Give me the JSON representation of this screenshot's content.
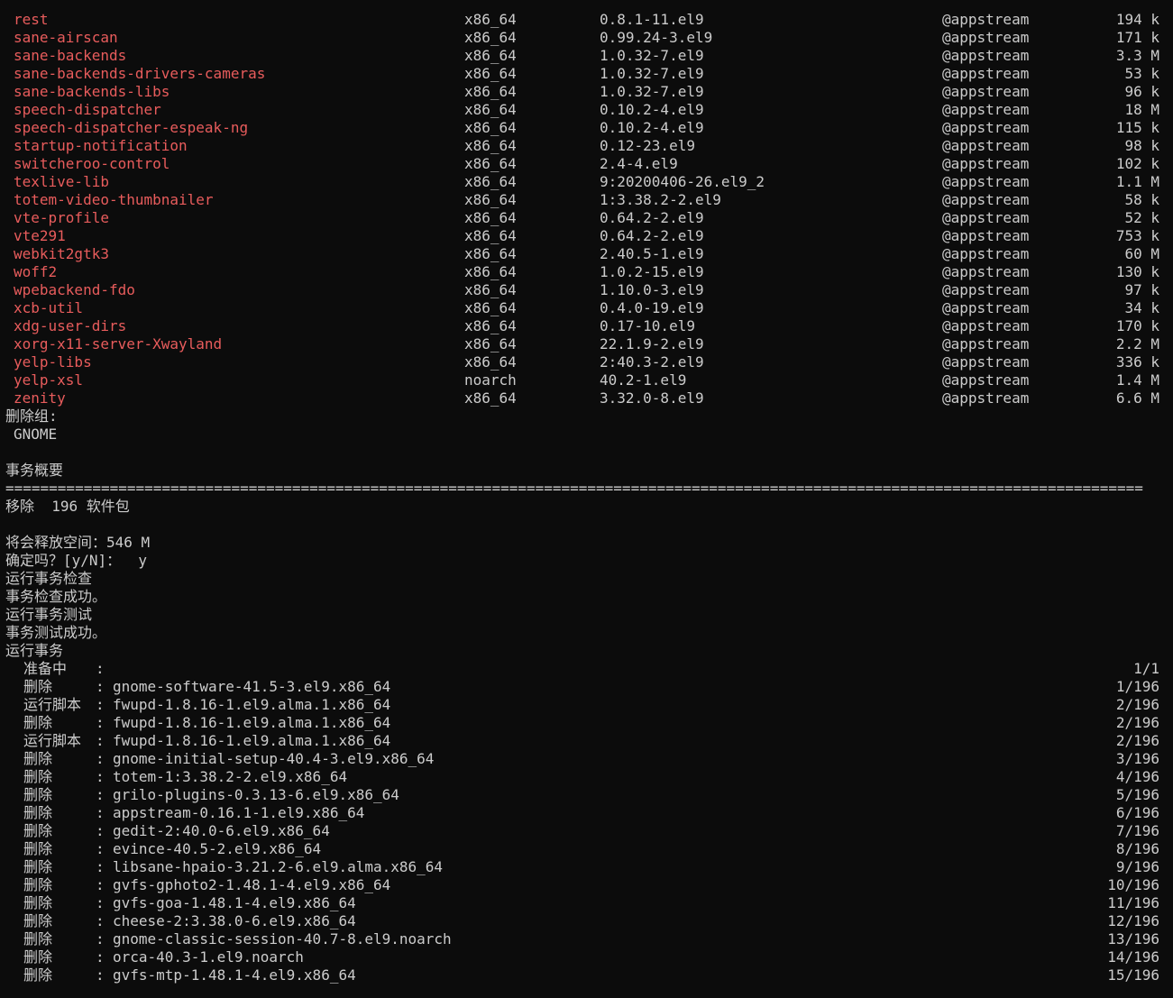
{
  "packages": [
    {
      "name": "rest",
      "arch": "x86_64",
      "version": "0.8.1-11.el9",
      "repo": "@appstream",
      "size": "194 k"
    },
    {
      "name": "sane-airscan",
      "arch": "x86_64",
      "version": "0.99.24-3.el9",
      "repo": "@appstream",
      "size": "171 k"
    },
    {
      "name": "sane-backends",
      "arch": "x86_64",
      "version": "1.0.32-7.el9",
      "repo": "@appstream",
      "size": "3.3 M"
    },
    {
      "name": "sane-backends-drivers-cameras",
      "arch": "x86_64",
      "version": "1.0.32-7.el9",
      "repo": "@appstream",
      "size": "53 k"
    },
    {
      "name": "sane-backends-libs",
      "arch": "x86_64",
      "version": "1.0.32-7.el9",
      "repo": "@appstream",
      "size": "96 k"
    },
    {
      "name": "speech-dispatcher",
      "arch": "x86_64",
      "version": "0.10.2-4.el9",
      "repo": "@appstream",
      "size": "18 M"
    },
    {
      "name": "speech-dispatcher-espeak-ng",
      "arch": "x86_64",
      "version": "0.10.2-4.el9",
      "repo": "@appstream",
      "size": "115 k"
    },
    {
      "name": "startup-notification",
      "arch": "x86_64",
      "version": "0.12-23.el9",
      "repo": "@appstream",
      "size": "98 k"
    },
    {
      "name": "switcheroo-control",
      "arch": "x86_64",
      "version": "2.4-4.el9",
      "repo": "@appstream",
      "size": "102 k"
    },
    {
      "name": "texlive-lib",
      "arch": "x86_64",
      "version": "9:20200406-26.el9_2",
      "repo": "@appstream",
      "size": "1.1 M"
    },
    {
      "name": "totem-video-thumbnailer",
      "arch": "x86_64",
      "version": "1:3.38.2-2.el9",
      "repo": "@appstream",
      "size": "58 k"
    },
    {
      "name": "vte-profile",
      "arch": "x86_64",
      "version": "0.64.2-2.el9",
      "repo": "@appstream",
      "size": "52 k"
    },
    {
      "name": "vte291",
      "arch": "x86_64",
      "version": "0.64.2-2.el9",
      "repo": "@appstream",
      "size": "753 k"
    },
    {
      "name": "webkit2gtk3",
      "arch": "x86_64",
      "version": "2.40.5-1.el9",
      "repo": "@appstream",
      "size": "60 M"
    },
    {
      "name": "woff2",
      "arch": "x86_64",
      "version": "1.0.2-15.el9",
      "repo": "@appstream",
      "size": "130 k"
    },
    {
      "name": "wpebackend-fdo",
      "arch": "x86_64",
      "version": "1.10.0-3.el9",
      "repo": "@appstream",
      "size": "97 k"
    },
    {
      "name": "xcb-util",
      "arch": "x86_64",
      "version": "0.4.0-19.el9",
      "repo": "@appstream",
      "size": "34 k"
    },
    {
      "name": "xdg-user-dirs",
      "arch": "x86_64",
      "version": "0.17-10.el9",
      "repo": "@appstream",
      "size": "170 k"
    },
    {
      "name": "xorg-x11-server-Xwayland",
      "arch": "x86_64",
      "version": "22.1.9-2.el9",
      "repo": "@appstream",
      "size": "2.2 M"
    },
    {
      "name": "yelp-libs",
      "arch": "x86_64",
      "version": "2:40.3-2.el9",
      "repo": "@appstream",
      "size": "336 k"
    },
    {
      "name": "yelp-xsl",
      "arch": "noarch",
      "version": "40.2-1.el9",
      "repo": "@appstream",
      "size": "1.4 M"
    },
    {
      "name": "zenity",
      "arch": "x86_64",
      "version": "3.32.0-8.el9",
      "repo": "@appstream",
      "size": "6.6 M"
    }
  ],
  "remove_groups_heading": "删除组:",
  "remove_group": "GNOME",
  "summary_heading": "事务概要",
  "separator": "===================================================================================================================================",
  "remove_summary": "移除  196 软件包",
  "space_freed": "将会释放空间：546 M",
  "confirm_prompt": "确定吗？[y/N]：  y",
  "status_lines": [
    "运行事务检查",
    "事务检查成功。",
    "运行事务测试",
    "事务测试成功。",
    "运行事务"
  ],
  "operations": [
    {
      "label": "准备中",
      "target": "",
      "progress": "1/1"
    },
    {
      "label": "删除",
      "target": "gnome-software-41.5-3.el9.x86_64",
      "progress": "1/196"
    },
    {
      "label": "运行脚本",
      "target": "fwupd-1.8.16-1.el9.alma.1.x86_64",
      "progress": "2/196"
    },
    {
      "label": "删除",
      "target": "fwupd-1.8.16-1.el9.alma.1.x86_64",
      "progress": "2/196"
    },
    {
      "label": "运行脚本",
      "target": "fwupd-1.8.16-1.el9.alma.1.x86_64",
      "progress": "2/196"
    },
    {
      "label": "删除",
      "target": "gnome-initial-setup-40.4-3.el9.x86_64",
      "progress": "3/196"
    },
    {
      "label": "删除",
      "target": "totem-1:3.38.2-2.el9.x86_64",
      "progress": "4/196"
    },
    {
      "label": "删除",
      "target": "grilo-plugins-0.3.13-6.el9.x86_64",
      "progress": "5/196"
    },
    {
      "label": "删除",
      "target": "appstream-0.16.1-1.el9.x86_64",
      "progress": "6/196"
    },
    {
      "label": "删除",
      "target": "gedit-2:40.0-6.el9.x86_64",
      "progress": "7/196"
    },
    {
      "label": "删除",
      "target": "evince-40.5-2.el9.x86_64",
      "progress": "8/196"
    },
    {
      "label": "删除",
      "target": "libsane-hpaio-3.21.2-6.el9.alma.x86_64",
      "progress": "9/196"
    },
    {
      "label": "删除",
      "target": "gvfs-gphoto2-1.48.1-4.el9.x86_64",
      "progress": "10/196"
    },
    {
      "label": "删除",
      "target": "gvfs-goa-1.48.1-4.el9.x86_64",
      "progress": "11/196"
    },
    {
      "label": "删除",
      "target": "cheese-2:3.38.0-6.el9.x86_64",
      "progress": "12/196"
    },
    {
      "label": "删除",
      "target": "gnome-classic-session-40.7-8.el9.noarch",
      "progress": "13/196"
    },
    {
      "label": "删除",
      "target": "orca-40.3-1.el9.noarch",
      "progress": "14/196"
    },
    {
      "label": "删除",
      "target": "gvfs-mtp-1.48.1-4.el9.x86_64",
      "progress": "15/196"
    }
  ]
}
